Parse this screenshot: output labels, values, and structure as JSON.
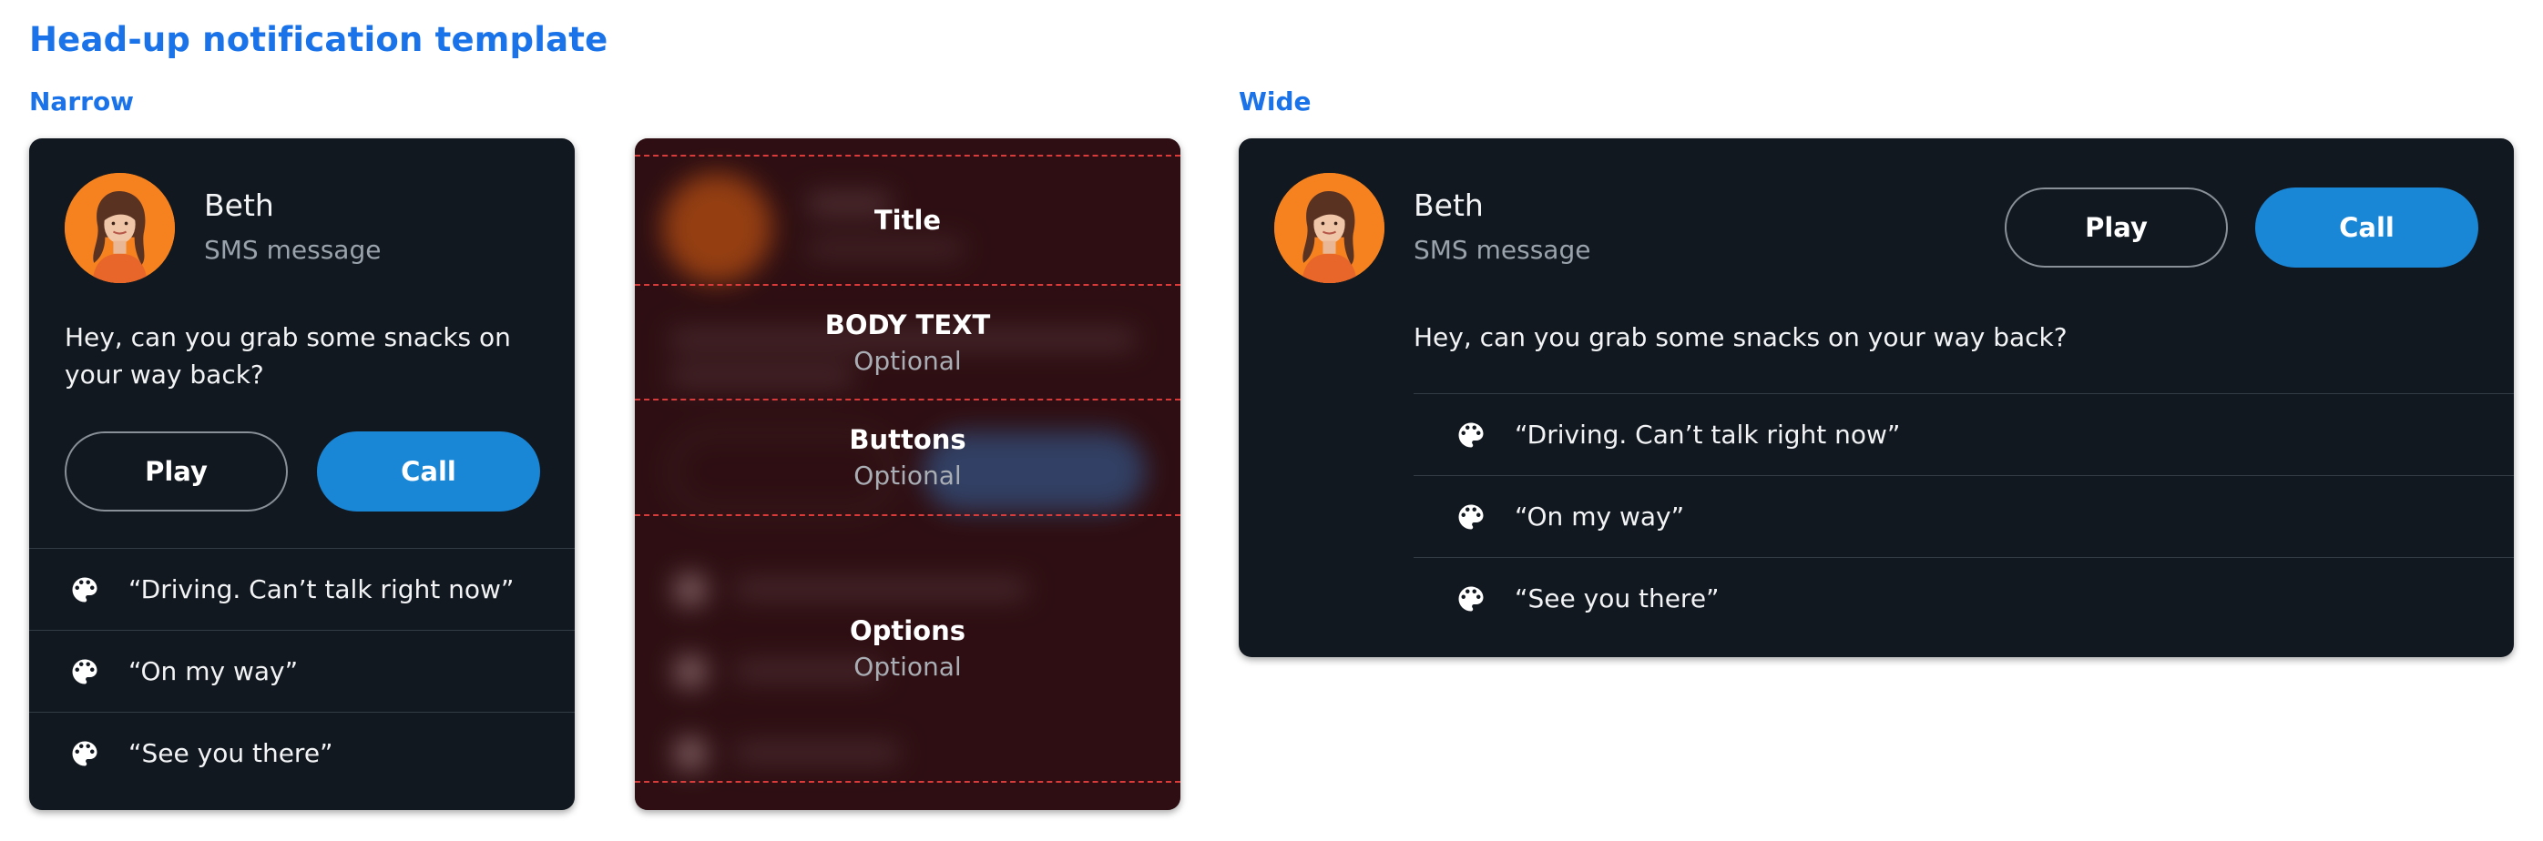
{
  "page": {
    "title": "Head-up notification template"
  },
  "sections": {
    "narrow": "Narrow",
    "wide": "Wide"
  },
  "notification": {
    "sender": "Beth",
    "subtitle": "SMS message",
    "body": "Hey, can you grab some snacks on your way back?",
    "buttons": {
      "play": "Play",
      "call": "Call"
    },
    "options": [
      {
        "label": "“Driving. Can’t talk right now”",
        "icon": "palette-icon"
      },
      {
        "label": "“On my way”",
        "icon": "palette-icon"
      },
      {
        "label": "“See you there”",
        "icon": "palette-icon"
      }
    ]
  },
  "spec": {
    "title": {
      "name": "Title"
    },
    "body": {
      "name": "BODY TEXT",
      "sub": "Optional"
    },
    "buttons": {
      "name": "Buttons",
      "sub": "Optional"
    },
    "options": {
      "name": "Options",
      "sub": "Optional"
    }
  },
  "colors": {
    "accent": "#1a73e8",
    "card_bg": "#121820",
    "call_button": "#1a86d6",
    "avatar_bg": "#f5821f",
    "guide_line": "#d93a3a"
  }
}
